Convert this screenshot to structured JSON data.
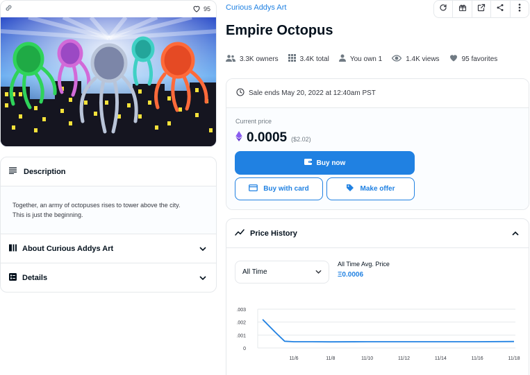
{
  "item": {
    "collection": "Curious Addys Art",
    "title": "Empire Octopus",
    "favorites_count": "95"
  },
  "stats": {
    "owners": "3.3K owners",
    "total": "3.4K total",
    "you_own": "You own 1",
    "views": "1.4K views",
    "favorites": "95 favorites"
  },
  "description": {
    "heading": "Description",
    "text_line1": "Together, an army of octopuses rises to tower above the city.",
    "text_line2": "This is just the beginning."
  },
  "accordions": {
    "about": "About Curious Addys Art",
    "details": "Details"
  },
  "sale": {
    "ends": "Sale ends May 20, 2022 at 12:40am PST",
    "current_price_label": "Current price",
    "price": "0.0005",
    "price_usd": "($2.02)",
    "buy_now": "Buy now",
    "buy_with_card": "Buy with card",
    "make_offer": "Make offer"
  },
  "price_history": {
    "heading": "Price History",
    "range_selected": "All Time",
    "avg_label": "All Time Avg. Price",
    "avg_value": "Ξ0.0006"
  },
  "chart_data": {
    "type": "line",
    "x_ticks": [
      "11/6",
      "11/8",
      "11/10",
      "11/12",
      "11/14",
      "11/16",
      "11/18"
    ],
    "y_ticks": [
      ".003",
      ".002",
      ".001",
      "0"
    ],
    "ylim": [
      0,
      0.003
    ],
    "series": [
      {
        "x": [
          4.3,
          5.0,
          5.5,
          6.0,
          7.0,
          8.0,
          10.0,
          12.0,
          14.0,
          16.0,
          18.0
        ],
        "values": [
          0.0022,
          0.0012,
          0.00052,
          0.00048,
          0.00048,
          0.00047,
          0.00048,
          0.00048,
          0.00048,
          0.00048,
          0.0005
        ]
      }
    ]
  },
  "colors": {
    "accent": "#2081e2",
    "text": "#04111d",
    "muted": "#707a83",
    "border": "#e5e8eb"
  }
}
